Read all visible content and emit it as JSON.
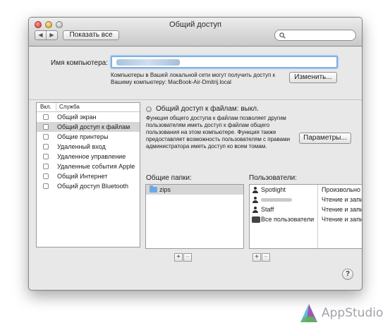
{
  "window": {
    "title": "Общий доступ",
    "nav_back": "◀",
    "nav_forward": "▶",
    "show_all_label": "Показать все",
    "search_placeholder": ""
  },
  "computer_name": {
    "label": "Имя компьютера:",
    "value": "",
    "note": "Компьютеры в Вашей локальной сети могут получить доступ к Вашему компьютеру: MacBook-Air-Dmitrij.local",
    "change_button": "Изменить..."
  },
  "services": {
    "header_on": "Вкл.",
    "header_service": "Служба",
    "items": [
      {
        "label": "Общий экран",
        "checked": false,
        "selected": false
      },
      {
        "label": "Общий доступ к файлам",
        "checked": false,
        "selected": true
      },
      {
        "label": "Общие принтеры",
        "checked": false,
        "selected": false
      },
      {
        "label": "Удаленный вход",
        "checked": false,
        "selected": false
      },
      {
        "label": "Удаленное управление",
        "checked": false,
        "selected": false
      },
      {
        "label": "Удаленные события Apple",
        "checked": false,
        "selected": false
      },
      {
        "label": "Общий Интернет",
        "checked": false,
        "selected": false
      },
      {
        "label": "Общий доступ Bluetooth",
        "checked": false,
        "selected": false
      }
    ]
  },
  "detail": {
    "status": "Общий доступ к файлам: выкл.",
    "description": "Функция общего доступа к файлам позволяет другим пользователям иметь доступ к файлам общего пользования на этом компьютере. Функция также предоставляет возможность пользователям с правами администратора иметь доступ ко всем томам.",
    "params_button": "Параметры...",
    "shared_folders_label": "Общие папки:",
    "users_label": "Пользователи:",
    "folders": [
      {
        "name": "zips",
        "icon": "folder-icon"
      }
    ],
    "users": [
      {
        "name": "Spotlight",
        "permission": "Произвольно",
        "icon": "user-icon"
      },
      {
        "name": "",
        "permission": "Чтение и запись",
        "icon": "user-icon"
      },
      {
        "name": "Staff",
        "permission": "Чтение и запись",
        "icon": "user-icon"
      },
      {
        "name": "Все пользователи",
        "permission": "Чтение и запись",
        "icon": "group-icon"
      }
    ],
    "add_label": "+",
    "remove_label": "−"
  },
  "help_label": "?",
  "watermark": "AppStudio"
}
